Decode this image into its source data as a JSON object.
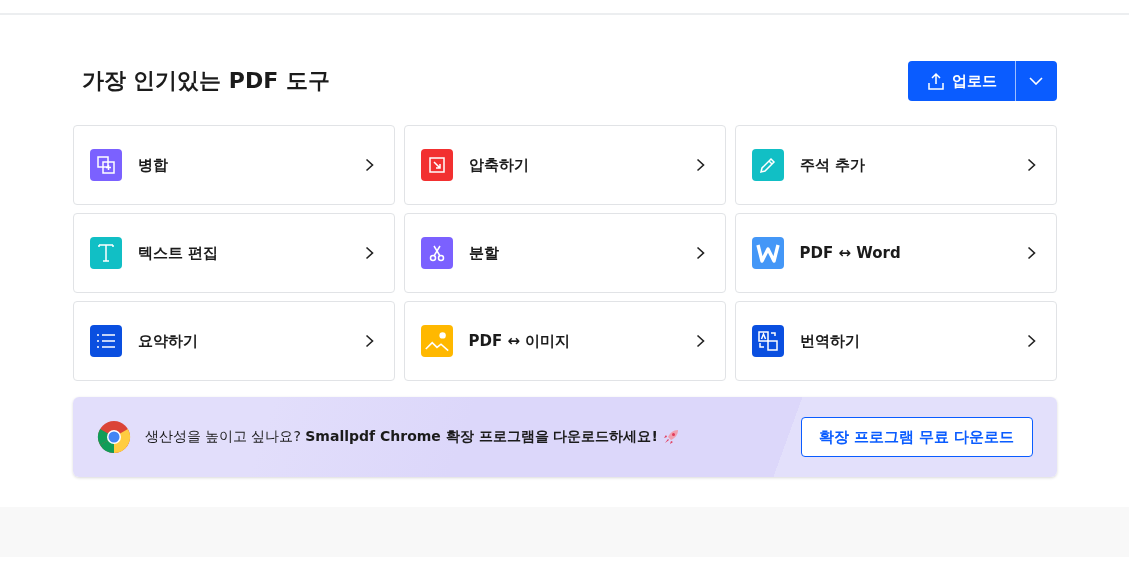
{
  "heading": "가장 인기있는 PDF 도구",
  "upload_button": {
    "label": "업로드"
  },
  "tools": [
    {
      "label": "병합",
      "kind": "merge",
      "color": "#7b61ff"
    },
    {
      "label": "압축하기",
      "kind": "compress",
      "color": "#f23030"
    },
    {
      "label": "주석 추가",
      "kind": "pencil",
      "color": "#11bfc5"
    },
    {
      "label": "텍스트 편집",
      "kind": "text",
      "color": "#11bfc5"
    },
    {
      "label": "분할",
      "kind": "scissors",
      "color": "#7b61ff"
    },
    {
      "label": "PDF ↔ Word",
      "kind": "word",
      "color": "#4497f7"
    },
    {
      "label": "요약하기",
      "kind": "list",
      "color": "#0a4fe0"
    },
    {
      "label": "PDF ↔ 이미지",
      "kind": "image",
      "color": "#ffb800"
    },
    {
      "label": "번역하기",
      "kind": "translate",
      "color": "#0a4fe0"
    }
  ],
  "banner": {
    "text": "생산성을 높이고 싶나요? **Smallpdf Chrome 확장 프로그램을 다운로드하세요!**",
    "button": "확장 프로그램 무료 다운로드"
  }
}
